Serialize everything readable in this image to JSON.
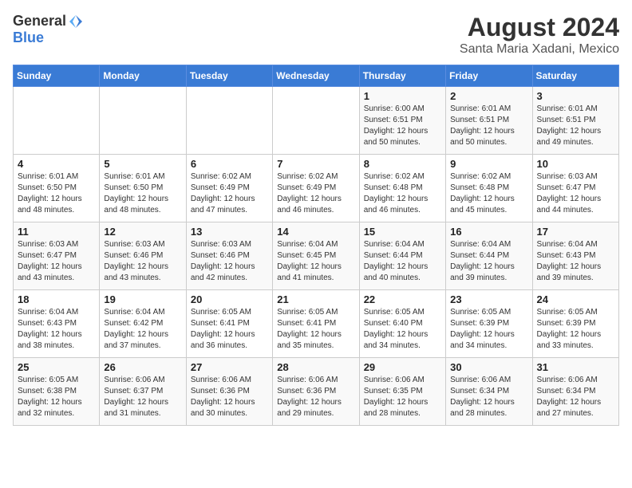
{
  "logo": {
    "line1": "General",
    "line2": "Blue"
  },
  "title": "August 2024",
  "location": "Santa Maria Xadani, Mexico",
  "weekdays": [
    "Sunday",
    "Monday",
    "Tuesday",
    "Wednesday",
    "Thursday",
    "Friday",
    "Saturday"
  ],
  "weeks": [
    [
      {
        "day": "",
        "info": ""
      },
      {
        "day": "",
        "info": ""
      },
      {
        "day": "",
        "info": ""
      },
      {
        "day": "",
        "info": ""
      },
      {
        "day": "1",
        "info": "Sunrise: 6:00 AM\nSunset: 6:51 PM\nDaylight: 12 hours\nand 50 minutes."
      },
      {
        "day": "2",
        "info": "Sunrise: 6:01 AM\nSunset: 6:51 PM\nDaylight: 12 hours\nand 50 minutes."
      },
      {
        "day": "3",
        "info": "Sunrise: 6:01 AM\nSunset: 6:51 PM\nDaylight: 12 hours\nand 49 minutes."
      }
    ],
    [
      {
        "day": "4",
        "info": "Sunrise: 6:01 AM\nSunset: 6:50 PM\nDaylight: 12 hours\nand 48 minutes."
      },
      {
        "day": "5",
        "info": "Sunrise: 6:01 AM\nSunset: 6:50 PM\nDaylight: 12 hours\nand 48 minutes."
      },
      {
        "day": "6",
        "info": "Sunrise: 6:02 AM\nSunset: 6:49 PM\nDaylight: 12 hours\nand 47 minutes."
      },
      {
        "day": "7",
        "info": "Sunrise: 6:02 AM\nSunset: 6:49 PM\nDaylight: 12 hours\nand 46 minutes."
      },
      {
        "day": "8",
        "info": "Sunrise: 6:02 AM\nSunset: 6:48 PM\nDaylight: 12 hours\nand 46 minutes."
      },
      {
        "day": "9",
        "info": "Sunrise: 6:02 AM\nSunset: 6:48 PM\nDaylight: 12 hours\nand 45 minutes."
      },
      {
        "day": "10",
        "info": "Sunrise: 6:03 AM\nSunset: 6:47 PM\nDaylight: 12 hours\nand 44 minutes."
      }
    ],
    [
      {
        "day": "11",
        "info": "Sunrise: 6:03 AM\nSunset: 6:47 PM\nDaylight: 12 hours\nand 43 minutes."
      },
      {
        "day": "12",
        "info": "Sunrise: 6:03 AM\nSunset: 6:46 PM\nDaylight: 12 hours\nand 43 minutes."
      },
      {
        "day": "13",
        "info": "Sunrise: 6:03 AM\nSunset: 6:46 PM\nDaylight: 12 hours\nand 42 minutes."
      },
      {
        "day": "14",
        "info": "Sunrise: 6:04 AM\nSunset: 6:45 PM\nDaylight: 12 hours\nand 41 minutes."
      },
      {
        "day": "15",
        "info": "Sunrise: 6:04 AM\nSunset: 6:44 PM\nDaylight: 12 hours\nand 40 minutes."
      },
      {
        "day": "16",
        "info": "Sunrise: 6:04 AM\nSunset: 6:44 PM\nDaylight: 12 hours\nand 39 minutes."
      },
      {
        "day": "17",
        "info": "Sunrise: 6:04 AM\nSunset: 6:43 PM\nDaylight: 12 hours\nand 39 minutes."
      }
    ],
    [
      {
        "day": "18",
        "info": "Sunrise: 6:04 AM\nSunset: 6:43 PM\nDaylight: 12 hours\nand 38 minutes."
      },
      {
        "day": "19",
        "info": "Sunrise: 6:04 AM\nSunset: 6:42 PM\nDaylight: 12 hours\nand 37 minutes."
      },
      {
        "day": "20",
        "info": "Sunrise: 6:05 AM\nSunset: 6:41 PM\nDaylight: 12 hours\nand 36 minutes."
      },
      {
        "day": "21",
        "info": "Sunrise: 6:05 AM\nSunset: 6:41 PM\nDaylight: 12 hours\nand 35 minutes."
      },
      {
        "day": "22",
        "info": "Sunrise: 6:05 AM\nSunset: 6:40 PM\nDaylight: 12 hours\nand 34 minutes."
      },
      {
        "day": "23",
        "info": "Sunrise: 6:05 AM\nSunset: 6:39 PM\nDaylight: 12 hours\nand 34 minutes."
      },
      {
        "day": "24",
        "info": "Sunrise: 6:05 AM\nSunset: 6:39 PM\nDaylight: 12 hours\nand 33 minutes."
      }
    ],
    [
      {
        "day": "25",
        "info": "Sunrise: 6:05 AM\nSunset: 6:38 PM\nDaylight: 12 hours\nand 32 minutes."
      },
      {
        "day": "26",
        "info": "Sunrise: 6:06 AM\nSunset: 6:37 PM\nDaylight: 12 hours\nand 31 minutes."
      },
      {
        "day": "27",
        "info": "Sunrise: 6:06 AM\nSunset: 6:36 PM\nDaylight: 12 hours\nand 30 minutes."
      },
      {
        "day": "28",
        "info": "Sunrise: 6:06 AM\nSunset: 6:36 PM\nDaylight: 12 hours\nand 29 minutes."
      },
      {
        "day": "29",
        "info": "Sunrise: 6:06 AM\nSunset: 6:35 PM\nDaylight: 12 hours\nand 28 minutes."
      },
      {
        "day": "30",
        "info": "Sunrise: 6:06 AM\nSunset: 6:34 PM\nDaylight: 12 hours\nand 28 minutes."
      },
      {
        "day": "31",
        "info": "Sunrise: 6:06 AM\nSunset: 6:34 PM\nDaylight: 12 hours\nand 27 minutes."
      }
    ]
  ]
}
